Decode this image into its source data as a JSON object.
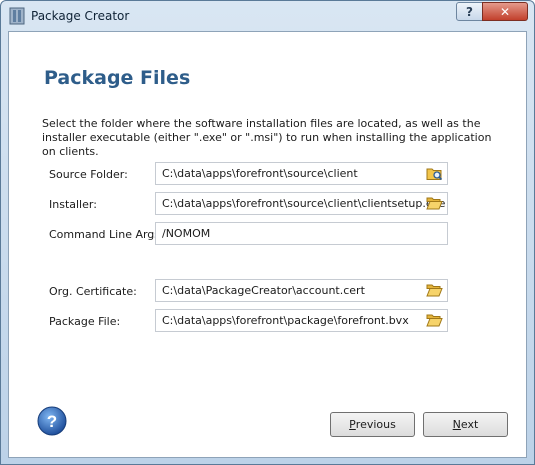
{
  "window": {
    "title": "Package Creator",
    "help_glyph": "?",
    "close_glyph": "✕"
  },
  "page": {
    "heading": "Package Files",
    "description": "Select the folder where the software installation files are located, as well as the installer executable (either \".exe\" or \".msi\") to run when installing the application on clients."
  },
  "fields": {
    "source_folder": {
      "label": "Source Folder:",
      "value": "C:\\data\\apps\\forefront\\source\\client"
    },
    "installer": {
      "label": "Installer:",
      "value": "C:\\data\\apps\\forefront\\source\\client\\clientsetup.exe"
    },
    "command_line": {
      "label": "Command Line Args:",
      "value": "/NOMOM"
    },
    "org_certificate": {
      "label": "Org. Certificate:",
      "value": "C:\\data\\PackageCreator\\account.cert"
    },
    "package_file": {
      "label": "Package File:",
      "value": "C:\\data\\apps\\forefront\\package\\forefront.bvx"
    }
  },
  "buttons": {
    "previous": {
      "accel": "P",
      "rest": "revious"
    },
    "next": {
      "accel": "N",
      "rest": "ext"
    }
  }
}
